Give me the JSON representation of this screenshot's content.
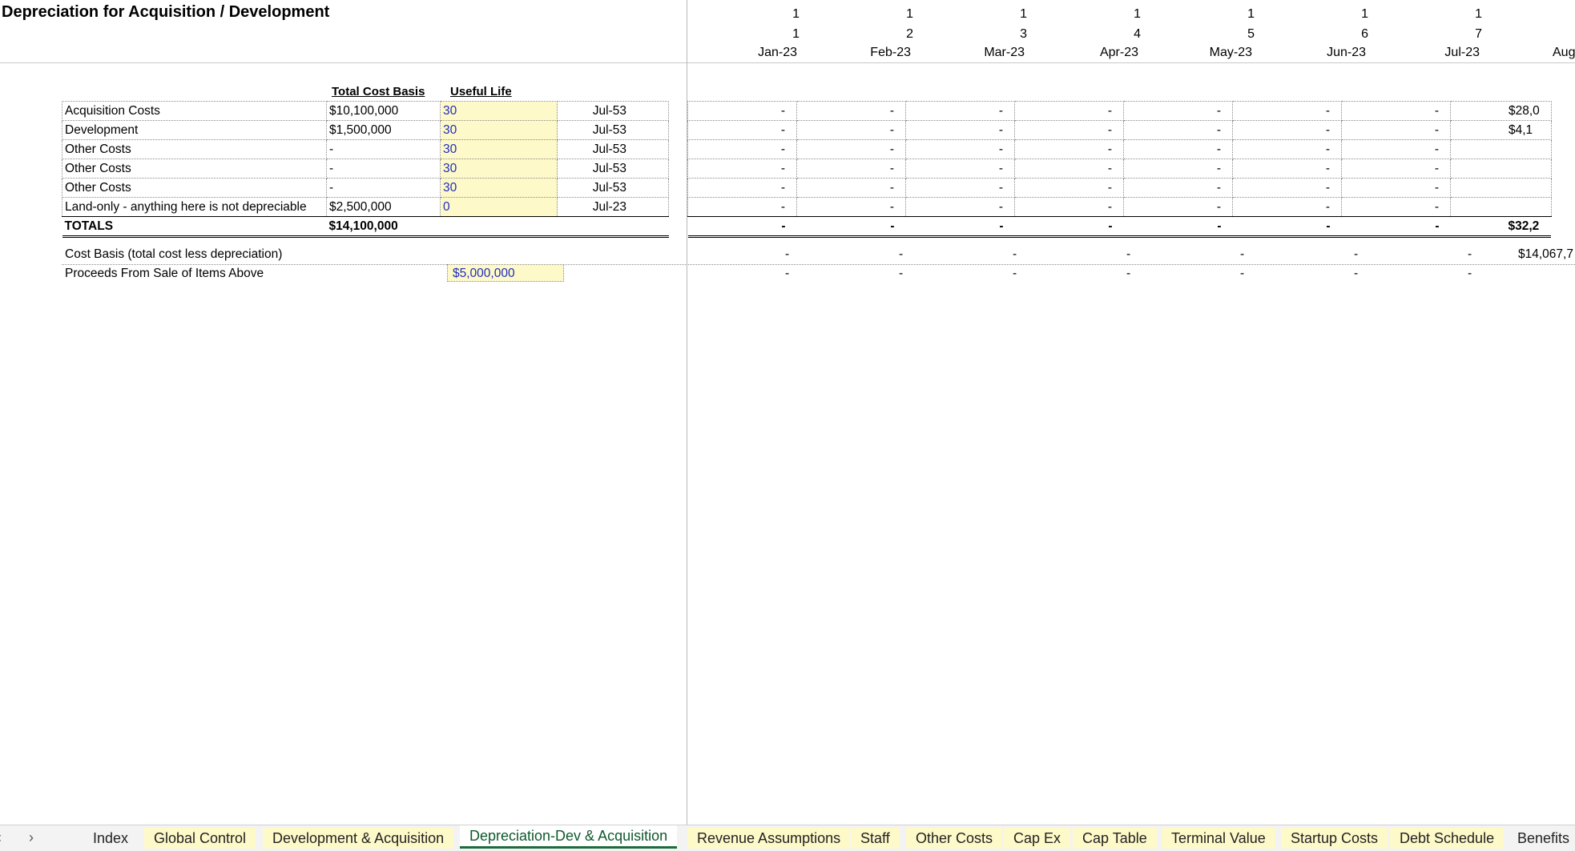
{
  "sheet": {
    "title": "Depreciation for Acquisition / Development",
    "header_row1": [
      "1",
      "1",
      "1",
      "1",
      "1",
      "1",
      "1"
    ],
    "header_row2": [
      "1",
      "2",
      "3",
      "4",
      "5",
      "6",
      "7"
    ],
    "header_dates": [
      "Jan-23",
      "Feb-23",
      "Mar-23",
      "Apr-23",
      "May-23",
      "Jun-23",
      "Jul-23",
      "Aug"
    ],
    "col_total_cost": "Total Cost Basis",
    "col_useful_life": "Useful Life",
    "rows": [
      {
        "label": "Acquisition Costs",
        "cost": "$10,100,000",
        "life": "30",
        "end": "Jul-53",
        "aug": "$28,0"
      },
      {
        "label": "Development",
        "cost": "$1,500,000",
        "life": "30",
        "end": "Jul-53",
        "aug": "$4,1"
      },
      {
        "label": "Other Costs",
        "cost": "-",
        "life": "30",
        "end": "Jul-53",
        "aug": ""
      },
      {
        "label": "Other Costs",
        "cost": "-",
        "life": "30",
        "end": "Jul-53",
        "aug": ""
      },
      {
        "label": "Other Costs",
        "cost": "-",
        "life": "30",
        "end": "Jul-53",
        "aug": ""
      },
      {
        "label": "Land-only - anything here is not depreciable",
        "cost": "$2,500,000",
        "life": "0",
        "end": "Jul-23",
        "aug": ""
      }
    ],
    "totals": {
      "label": "TOTALS",
      "cost": "$14,100,000",
      "aug": "$32,2"
    },
    "dash": "-",
    "cost_basis": {
      "label": "Cost Basis (total cost less depreciation)",
      "aug": "$14,067,7"
    },
    "proceeds": {
      "label": "Proceeds From Sale of Items Above",
      "value": "$5,000,000"
    }
  },
  "tabs": [
    {
      "label": "Index",
      "style": "plain"
    },
    {
      "label": "Global Control",
      "style": "yellow"
    },
    {
      "label": "Development & Acquisition",
      "style": "yellow"
    },
    {
      "label": "Depreciation-Dev & Acquisition",
      "style": "active"
    },
    {
      "label": "Revenue Assumptions",
      "style": "yellow"
    },
    {
      "label": "Staff",
      "style": "yellow"
    },
    {
      "label": "Other Costs",
      "style": "yellow"
    },
    {
      "label": "Cap Ex",
      "style": "yellow"
    },
    {
      "label": "Cap Table",
      "style": "yellow"
    },
    {
      "label": "Terminal Value",
      "style": "yellow"
    },
    {
      "label": "Startup Costs",
      "style": "yellow"
    },
    {
      "label": "Debt Schedule",
      "style": "yellow"
    },
    {
      "label": "Benefits",
      "style": "plain"
    }
  ],
  "nav": {
    "prev_icon": "chevron-left-icon",
    "next_icon": "chevron-right-icon",
    "prev": "‹",
    "next": "›"
  }
}
